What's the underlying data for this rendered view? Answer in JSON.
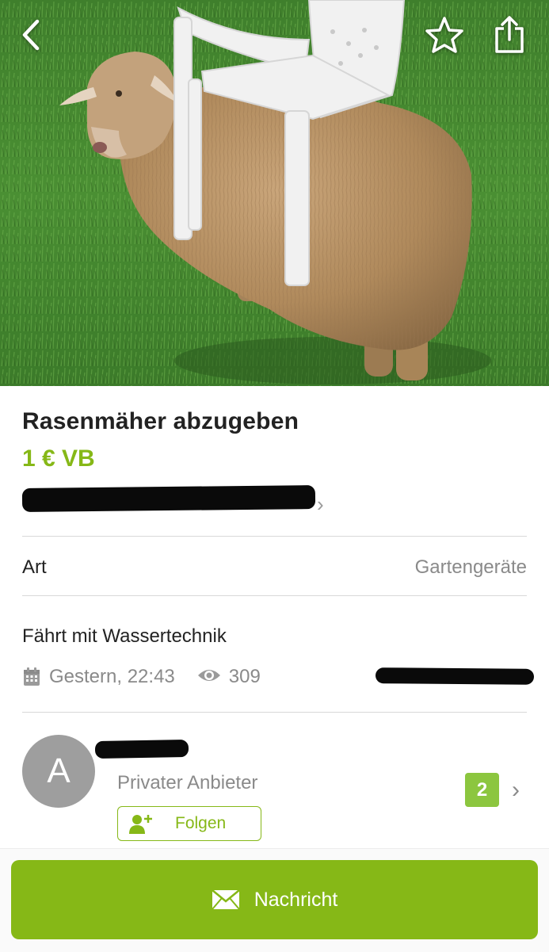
{
  "listing": {
    "title": "Rasenmäher abzugeben",
    "price": "1 € VB"
  },
  "details": {
    "category_label": "Art",
    "category_value": "Gartengeräte",
    "description": "Fährt mit Wassertechnik",
    "posted": "Gestern, 22:43",
    "views": "309"
  },
  "seller": {
    "avatar_initial": "A",
    "type": "Privater Anbieter",
    "listing_count": "2",
    "follow_label": "Folgen"
  },
  "actions": {
    "message_label": "Nachricht"
  },
  "icons": {
    "back": "chevron-left-icon",
    "favorite": "star-outline-icon",
    "share": "share-icon",
    "calendar": "calendar-icon",
    "views": "eye-icon",
    "follow": "person-add-icon",
    "message": "envelope-icon",
    "chevron": "chevron-right-icon"
  },
  "colors": {
    "accent": "#86b817",
    "badge": "#8cc63f",
    "avatar": "#9e9e9e"
  }
}
